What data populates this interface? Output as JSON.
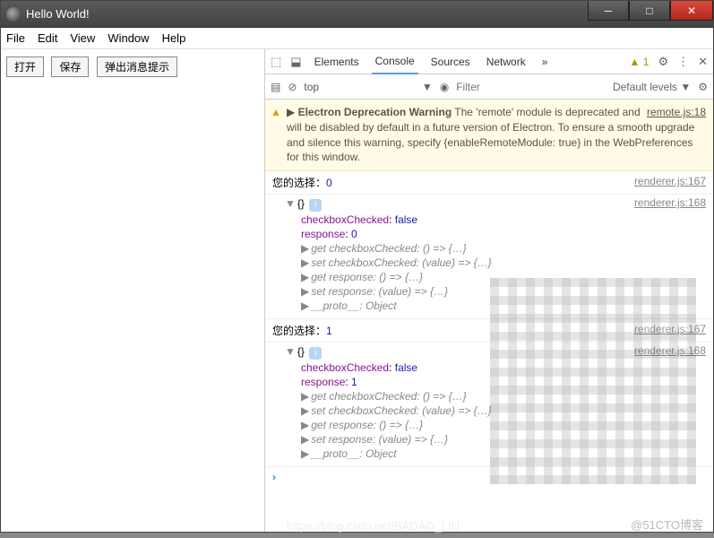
{
  "titlebar": {
    "title": "Hello World!"
  },
  "menubar": [
    "File",
    "Edit",
    "View",
    "Window",
    "Help"
  ],
  "buttons": {
    "open": "打开",
    "save": "保存",
    "popup": "弹出消息提示"
  },
  "devtools": {
    "tabs": [
      "Elements",
      "Console",
      "Sources",
      "Network"
    ],
    "active_tab": "Console",
    "more": "»",
    "warn_count": "1",
    "toolbar": {
      "context": "top",
      "filter_placeholder": "Filter",
      "levels": "Default levels ▼"
    },
    "warning": {
      "prefix": "Electron Deprecation Warning",
      "text": " The 'remote' module is deprecated and will be disabled by default in a future version of Electron. To ensure a smooth upgrade and silence this warning, specify {enableRemoteModule: true} in the WebPreferences for this window.",
      "src": "remote.js:18"
    },
    "logs": [
      {
        "text": "您的选择：",
        "val": "0",
        "src": "renderer.js:167",
        "obj_src": "renderer.js:168",
        "obj": {
          "checkboxChecked": "false",
          "response": "0",
          "getters": [
            "get checkboxChecked: () => {…}",
            "set checkboxChecked: (value) => {…}",
            "get response: () => {…}",
            "set response: (value) => {…}",
            "__proto__: Object"
          ]
        }
      },
      {
        "text": "您的选择：",
        "val": "1",
        "src": "renderer.js:167",
        "obj_src": "renderer.js:168",
        "obj": {
          "checkboxChecked": "false",
          "response": "1",
          "getters": [
            "get checkboxChecked: () => {…}",
            "set checkboxChecked: (value) => {…}",
            "get response: () => {…}",
            "set response: (value) => {…}",
            "__proto__: Object"
          ]
        }
      }
    ],
    "prompt": "›"
  },
  "watermark": "@51CTO博客",
  "faded_url": "https://blog.csdn.net/BADAO_LIU"
}
